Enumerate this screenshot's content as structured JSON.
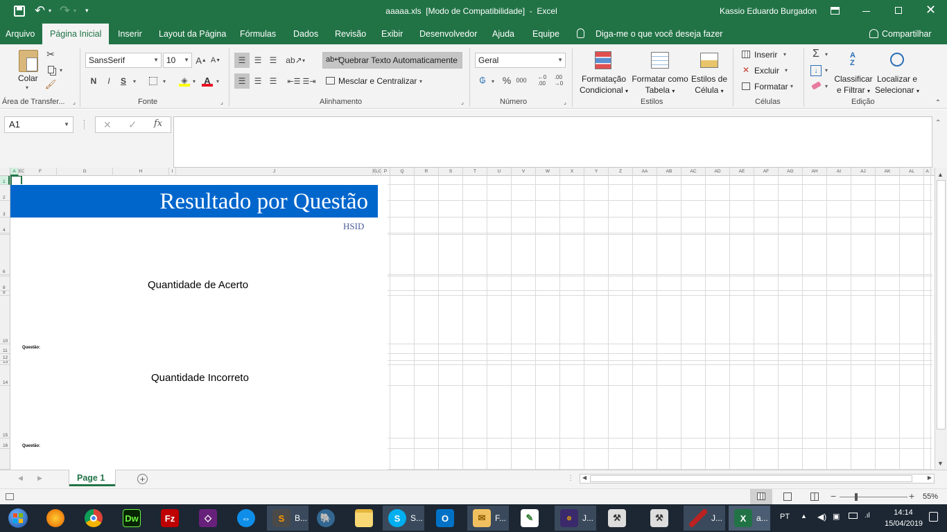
{
  "titlebar": {
    "title": "aaaaa.xls  [Modo de Compatibilidade]  -  Excel",
    "user": "Kassio Eduardo Burgadon"
  },
  "tabs": [
    "Arquivo",
    "Página Inicial",
    "Inserir",
    "Layout da Página",
    "Fórmulas",
    "Dados",
    "Revisão",
    "Exibir",
    "Desenvolvedor",
    "Ajuda",
    "Equipe"
  ],
  "tell_me": "Diga-me o que você deseja fazer",
  "share": "Compartilhar",
  "ribbon": {
    "clipboard": {
      "paste": "Colar",
      "label": "Área de Transfer..."
    },
    "font": {
      "name": "SansSerif",
      "size": "10",
      "bold": "N",
      "italic": "I",
      "underline": "S",
      "label": "Fonte"
    },
    "alignment": {
      "wrap": "Quebrar Texto Automaticamente",
      "merge": "Mesclar e Centralizar",
      "label": "Alinhamento"
    },
    "number": {
      "format": "Geral",
      "percent": "%",
      "thousands": "000",
      "label": "Número"
    },
    "styles": {
      "conditional_1": "Formatação",
      "conditional_2": "Condicional",
      "table_1": "Formatar como",
      "table_2": "Tabela",
      "cell_1": "Estilos de",
      "cell_2": "Célula",
      "label": "Estilos"
    },
    "cells": {
      "insert": "Inserir",
      "delete": "Excluir",
      "format": "Formatar",
      "label": "Células"
    },
    "editing": {
      "sort_1": "Classificar",
      "sort_2": "e Filtrar",
      "find_1": "Localizar e",
      "find_2": "Selecionar",
      "label": "Edição"
    }
  },
  "formula_bar": {
    "name_box": "A1",
    "cancel": "✕",
    "enter": "✓",
    "fx": "fx",
    "value": ""
  },
  "columns": [
    {
      "l": "A",
      "w": 12
    },
    {
      "l": "B",
      "w": 4
    },
    {
      "l": "C",
      "w": 4
    },
    {
      "l": "F",
      "w": 47
    },
    {
      "l": "G",
      "w": 81
    },
    {
      "l": "H",
      "w": 81
    },
    {
      "l": "I",
      "w": 10
    },
    {
      "l": "J",
      "w": 284
    },
    {
      "l": "E",
      "w": 4
    },
    {
      "l": "L",
      "w": 4
    },
    {
      "l": "C",
      "w": 4
    },
    {
      "l": "P",
      "w": 13
    },
    {
      "l": "Q",
      "w": 35
    },
    {
      "l": "R",
      "w": 35
    },
    {
      "l": "S",
      "w": 35
    },
    {
      "l": "T",
      "w": 35
    },
    {
      "l": "U",
      "w": 35
    },
    {
      "l": "V",
      "w": 35
    },
    {
      "l": "W",
      "w": 35
    },
    {
      "l": "X",
      "w": 35
    },
    {
      "l": "Y",
      "w": 35
    },
    {
      "l": "Z",
      "w": 35
    },
    {
      "l": "AA",
      "w": 35
    },
    {
      "l": "AB",
      "w": 35
    },
    {
      "l": "AC",
      "w": 35
    },
    {
      "l": "AD",
      "w": 35
    },
    {
      "l": "AE",
      "w": 35
    },
    {
      "l": "AF",
      "w": 35
    },
    {
      "l": "AG",
      "w": 35
    },
    {
      "l": "AH",
      "w": 35
    },
    {
      "l": "AI",
      "w": 35
    },
    {
      "l": "AJ",
      "w": 35
    },
    {
      "l": "AK",
      "w": 35
    },
    {
      "l": "AL",
      "w": 35
    },
    {
      "l": "A",
      "w": 10
    }
  ],
  "rows": [
    {
      "n": "1",
      "h": 13
    },
    {
      "n": "2",
      "h": 23
    },
    {
      "n": "3",
      "h": 24
    },
    {
      "n": "4",
      "h": 23
    },
    {
      "n": "",
      "h": 2
    },
    {
      "n": "6",
      "h": 58
    },
    {
      "n": "",
      "h": 2
    },
    {
      "n": "8",
      "h": 21
    },
    {
      "n": "9",
      "h": 7
    },
    {
      "n": "10",
      "h": 70
    },
    {
      "n": "11",
      "h": 14
    },
    {
      "n": "12",
      "h": 10
    },
    {
      "n": "13",
      "h": 6
    },
    {
      "n": "14",
      "h": 30
    },
    {
      "n": "15",
      "h": 76
    },
    {
      "n": "16",
      "h": 15
    },
    {
      "n": "",
      "h": 30
    }
  ],
  "report": {
    "title": "Resultado por Questão",
    "subtitle": "HSID",
    "chart1_title": "Quantidade de Acerto",
    "chart1_axis": "Questão:",
    "chart2_title": "Quantidade Incorreto",
    "chart2_axis": "Questão:"
  },
  "colors": {
    "excel_green": "#217346",
    "header_blue": "#0066cc"
  },
  "sheet_tab": "Page 1",
  "status": {
    "zoom": "55%"
  },
  "taskbar": {
    "items": [
      "B...",
      "S...",
      "F...",
      "J...",
      "J...",
      "a..."
    ],
    "lang": "PT",
    "time": "14:14",
    "date": "15/04/2019"
  }
}
